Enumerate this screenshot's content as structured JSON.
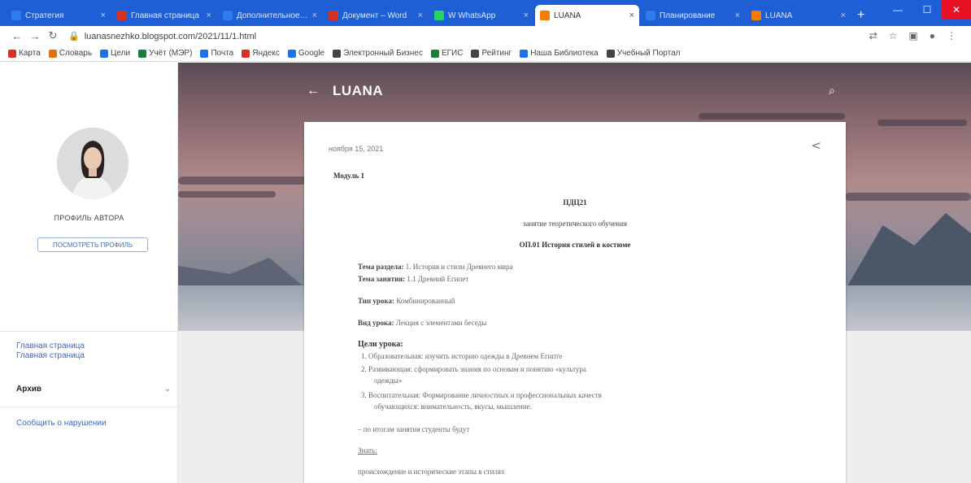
{
  "browser": {
    "tabs": [
      {
        "label": "Стратегия",
        "color": "#2b7de9",
        "active": false
      },
      {
        "label": "Главная страница",
        "color": "#d93025",
        "active": false
      },
      {
        "label": "Дополнительное образование",
        "color": "#2b7de9",
        "active": false
      },
      {
        "label": "Документ – Word",
        "color": "#d93025",
        "active": false
      },
      {
        "label": "W WhatsApp",
        "color": "#25d366",
        "active": false
      },
      {
        "label": "LUANA",
        "color": "#f57c00",
        "active": true
      },
      {
        "label": "Планирование",
        "color": "#2b7de9",
        "active": false
      },
      {
        "label": "LUANA",
        "color": "#f57c00",
        "active": false
      }
    ],
    "new_tab": "+",
    "url": "luanasnezhko.blogspot.com/2021/11/1.html",
    "bookmarks": [
      {
        "label": "Карта",
        "color": "#d93025"
      },
      {
        "label": "Словарь",
        "color": "#e8710a"
      },
      {
        "label": "Цели",
        "color": "#1a73e8"
      },
      {
        "label": "Учёт (МЭР)",
        "color": "#188038"
      },
      {
        "label": "Почта",
        "color": "#1a73e8"
      },
      {
        "label": "Яндекс",
        "color": "#d93025"
      },
      {
        "label": "Google",
        "color": "#1a73e8"
      },
      {
        "label": "Электронный Бизнес",
        "color": "#444444"
      },
      {
        "label": "ЕГИС",
        "color": "#188038"
      },
      {
        "label": "Рейтинг",
        "color": "#444444"
      },
      {
        "label": "Наша Библиотека",
        "color": "#1a73e8"
      },
      {
        "label": "Учебный Портал",
        "color": "#444444"
      }
    ]
  },
  "sidebar": {
    "profile_name": "ПРОФИЛЬ АВТОРА",
    "profile_button": "ПОСМОТРЕТЬ ПРОФИЛЬ",
    "links": [
      "Главная страница",
      "Главная страница"
    ],
    "archive_label": "Архив",
    "report_link": "Сообщить о нарушении"
  },
  "blog": {
    "title": "LUANA"
  },
  "post": {
    "date": "ноября 15, 2021",
    "heading": "Модуль 1",
    "lines": {
      "course": "ПДЦ21",
      "lesson_type": "занятие теоретического обучения",
      "mdk": "ОП.01 История стилей в костюме",
      "section_label": "Тема раздела:",
      "section_value": "1. История и стили Древнего мира",
      "topic_label": "Тема занятия:",
      "topic_value": "1.1 Древний Египет",
      "type_label": "Тип урока:",
      "type_value": "Комбинированный",
      "kind_label": "Вид урока:",
      "kind_value": "Лекция с элементами беседы",
      "goals_heading": "Цели урока:",
      "goal_1": "1.    Образовательная: изучить историю одежды в Древнем Египте",
      "goal_2a": "2.    Развивающая: сформировать знания по основам и понятию «культура",
      "goal_2b": "одежды»",
      "goal_3a": "3.    Воспитательная: Формирование личностных и профессиональных качеств",
      "goal_3b": "обучающихся: внимательность, вкусы, мышление.",
      "note": "– по итогам занятия студенты будут",
      "know": "Знать:",
      "last": "происхождение и исторические этапы в стилях"
    }
  },
  "colors": {
    "tabbar": "#1e5fd6",
    "link": "#3b67c4"
  }
}
